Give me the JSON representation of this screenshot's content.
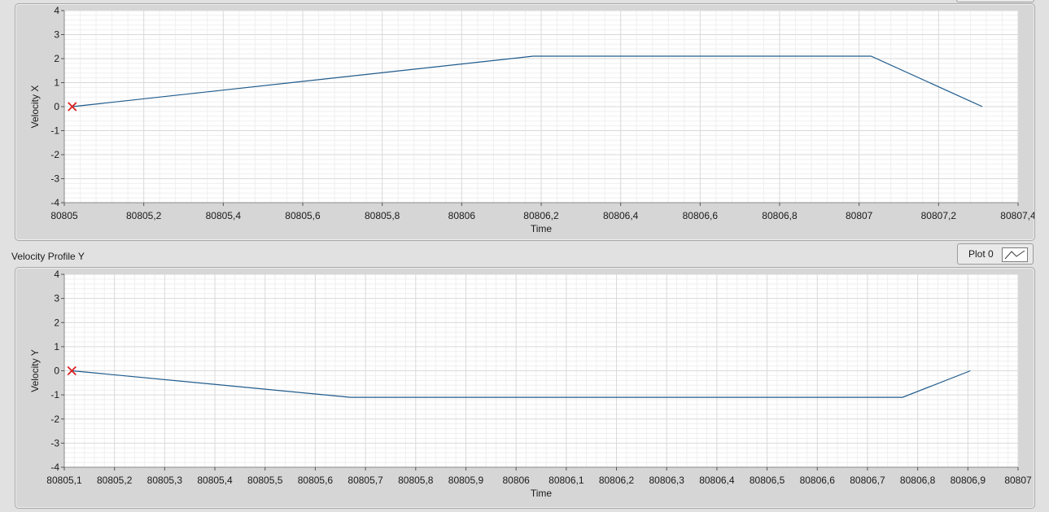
{
  "colors": {
    "line": "#1f5b8c",
    "cursor": "#d82020",
    "grid_major": "#d9d9d9",
    "grid_minor": "#efefef",
    "plot_bg": "#ffffff"
  },
  "legend": {
    "label": "Plot 0",
    "icon": "line-plot-icon"
  },
  "chart_data": [
    {
      "type": "line",
      "title": "",
      "xlabel": "Time",
      "ylabel": "Velocity X",
      "xlim": [
        80805,
        80807.4
      ],
      "ylim": [
        -4,
        4
      ],
      "grid": true,
      "x_ticks": [
        80805,
        80805.2,
        80805.4,
        80805.6,
        80805.8,
        80806,
        80806.2,
        80806.4,
        80806.6,
        80806.8,
        80807,
        80807.2,
        80807.4
      ],
      "x_tick_labels": [
        "80805",
        "80805,2",
        "80805,4",
        "80805,6",
        "80805,8",
        "80806",
        "80806,2",
        "80806,4",
        "80806,6",
        "80806,8",
        "80807",
        "80807,2",
        "80807,4"
      ],
      "y_ticks": [
        -4,
        -3,
        -2,
        -1,
        0,
        1,
        2,
        3,
        4
      ],
      "y_tick_labels": [
        "-4",
        "-3",
        "-2",
        "-1",
        "0",
        "1",
        "2",
        "3",
        "4"
      ],
      "series": [
        {
          "x": [
            80805.02,
            80806.18,
            80807.03,
            80807.31
          ],
          "y": [
            0,
            2.1,
            2.1,
            0
          ]
        }
      ],
      "cursor": {
        "x": 80805.02,
        "y": 0
      }
    },
    {
      "type": "line",
      "title": "Velocity Profile Y",
      "xlabel": "Time",
      "ylabel": "Velocity Y",
      "xlim": [
        80805.1,
        80807
      ],
      "ylim": [
        -4,
        4
      ],
      "grid": true,
      "x_ticks": [
        80805.1,
        80805.2,
        80805.3,
        80805.4,
        80805.5,
        80805.6,
        80805.7,
        80805.8,
        80805.9,
        80806,
        80806.1,
        80806.2,
        80806.3,
        80806.4,
        80806.5,
        80806.6,
        80806.7,
        80806.8,
        80806.9,
        80807
      ],
      "x_tick_labels": [
        "80805,1",
        "80805,2",
        "80805,3",
        "80805,4",
        "80805,5",
        "80805,6",
        "80805,7",
        "80805,8",
        "80805,9",
        "80806",
        "80806,1",
        "80806,2",
        "80806,3",
        "80806,4",
        "80806,5",
        "80806,6",
        "80806,7",
        "80806,8",
        "80806,9",
        "80807"
      ],
      "y_ticks": [
        -4,
        -3,
        -2,
        -1,
        0,
        1,
        2,
        3,
        4
      ],
      "y_tick_labels": [
        "-4",
        "-3",
        "-2",
        "-1",
        "0",
        "1",
        "2",
        "3",
        "4"
      ],
      "series": [
        {
          "x": [
            80805.115,
            80805.67,
            80806.77,
            80806.905
          ],
          "y": [
            0,
            -1.1,
            -1.1,
            0
          ]
        }
      ],
      "cursor": {
        "x": 80805.115,
        "y": 0
      }
    }
  ]
}
